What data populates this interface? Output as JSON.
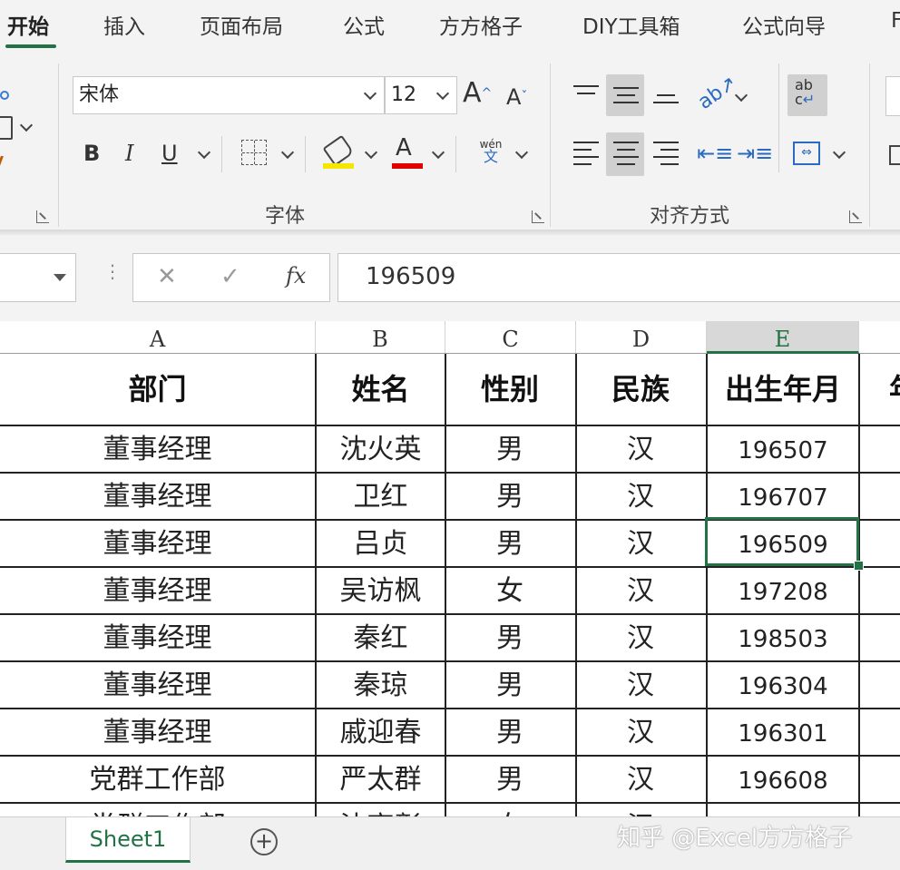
{
  "ribbon_tabs": [
    "开始",
    "插入",
    "页面布局",
    "公式",
    "方方格子",
    "DIY工具箱",
    "公式向导",
    "F"
  ],
  "font_group": {
    "font_name": "宋体",
    "font_size": "12",
    "grow_font": "A",
    "shrink_font": "A",
    "bold": "B",
    "italic": "I",
    "underline": "U",
    "font_color_letter": "A",
    "phonetic_top": "wén",
    "phonetic_bottom": "文",
    "label": "字体"
  },
  "align_group": {
    "label": "对齐方式",
    "wrap_text": "ab c"
  },
  "formula_bar": {
    "cancel": "✕",
    "enter": "✓",
    "fx": "fx",
    "value": "196509"
  },
  "columns": [
    "A",
    "B",
    "C",
    "D",
    "E"
  ],
  "table": {
    "headers": [
      "部门",
      "姓名",
      "性别",
      "民族",
      "出生年月",
      "年"
    ],
    "rows": [
      [
        "董事经理",
        "沈火英",
        "男",
        "汉",
        "196507"
      ],
      [
        "董事经理",
        "卫红",
        "男",
        "汉",
        "196707"
      ],
      [
        "董事经理",
        "吕贞",
        "男",
        "汉",
        "196509"
      ],
      [
        "董事经理",
        "吴访枫",
        "女",
        "汉",
        "197208"
      ],
      [
        "董事经理",
        "秦红",
        "男",
        "汉",
        "198503"
      ],
      [
        "董事经理",
        "秦琼",
        "男",
        "汉",
        "196304"
      ],
      [
        "董事经理",
        "戚迎春",
        "男",
        "汉",
        "196301"
      ],
      [
        "党群工作部",
        "严太群",
        "男",
        "汉",
        "196608"
      ],
      [
        "党群工作部",
        "沈高彰",
        "女",
        "汉",
        ""
      ]
    ]
  },
  "sheet_tabs": {
    "active": "Sheet1",
    "add": "+"
  },
  "watermark": "知乎 @Excel方方格子",
  "colors": {
    "accent": "#217346",
    "font_highlight": "#f4e600",
    "font_red": "#e00000"
  }
}
